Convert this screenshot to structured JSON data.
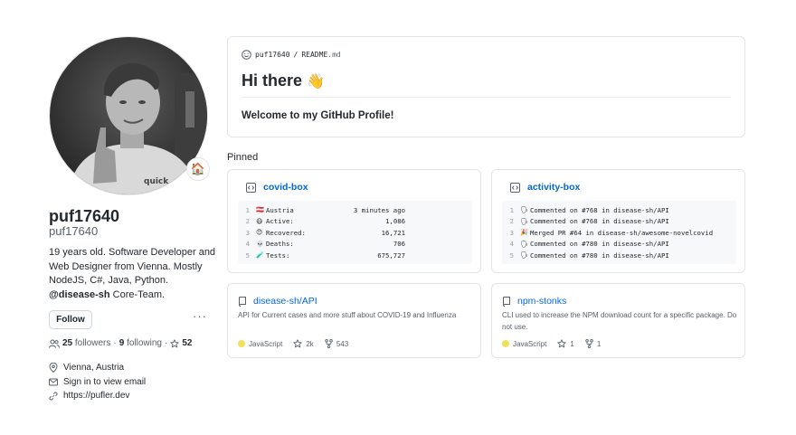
{
  "profile": {
    "fullname": "puf17640",
    "username": "puf17640",
    "status_emoji": "🏠",
    "bio_line1": "19 years old. Software Developer and",
    "bio_line2": "Web Designer from Vienna. Mostly",
    "bio_line3": "NodeJS, C#, Java, Python.",
    "bio_org": "@disease-sh",
    "bio_suffix": " Core-Team.",
    "follow_label": "Follow",
    "more_label": "···",
    "followers_count": "25",
    "followers_label": "followers",
    "separator": "·",
    "following_count": "9",
    "following_label": "following",
    "separator2": "·",
    "stars_count": "52",
    "location": "Vienna, Austria",
    "email": "Sign in to view email",
    "website": "https://pufler.dev"
  },
  "readme": {
    "owner": "puf17640",
    "slash": "/",
    "filename": "README",
    "ext": ".md",
    "title": "Hi there",
    "wave": "👋",
    "welcome": "Welcome to my GitHub Profile!"
  },
  "pinned_label": "Pinned",
  "covid_box": {
    "title": "covid-box",
    "lines": [
      {
        "n": "1",
        "icon": "🇦🇹",
        "label": "Austria",
        "value": "3 minutes ago"
      },
      {
        "n": "2",
        "icon": "😷",
        "label": "Active:",
        "value": "1,086"
      },
      {
        "n": "3",
        "icon": "😊",
        "label": "Recovered:",
        "value": "16,721"
      },
      {
        "n": "4",
        "icon": "💀",
        "label": "Deaths:",
        "value": "706"
      },
      {
        "n": "5",
        "icon": "🧪",
        "label": "Tests:",
        "value": "675,727"
      }
    ]
  },
  "activity_box": {
    "title": "activity-box",
    "lines": [
      {
        "n": "1",
        "icon": "🗣",
        "text": "Commented on #768 in disease-sh/API"
      },
      {
        "n": "2",
        "icon": "🗣",
        "text": "Commented on #768 in disease-sh/API"
      },
      {
        "n": "3",
        "icon": "🎉",
        "text": "Merged PR #64 in disease-sh/awesome-novelcovid"
      },
      {
        "n": "4",
        "icon": "🗣",
        "text": "Commented on #780 in disease-sh/API"
      },
      {
        "n": "5",
        "icon": "🗣",
        "text": "Commented on #780 in disease-sh/API"
      }
    ]
  },
  "repos": [
    {
      "name": "disease-sh/API",
      "description": "API for Current cases and more stuff about COVID-19 and Influenza",
      "language": "JavaScript",
      "language_color": "#f1e05a",
      "stars": "2k",
      "forks": "543"
    },
    {
      "name": "npm-stonks",
      "description": "CLI used to increase the NPM download count for a specific package. Do not use.",
      "language": "JavaScript",
      "language_color": "#f1e05a",
      "stars": "1",
      "forks": "1"
    }
  ],
  "colors": {
    "link": "#0366d6",
    "border": "#e1e4e8",
    "muted": "#586069",
    "text": "#24292e"
  }
}
